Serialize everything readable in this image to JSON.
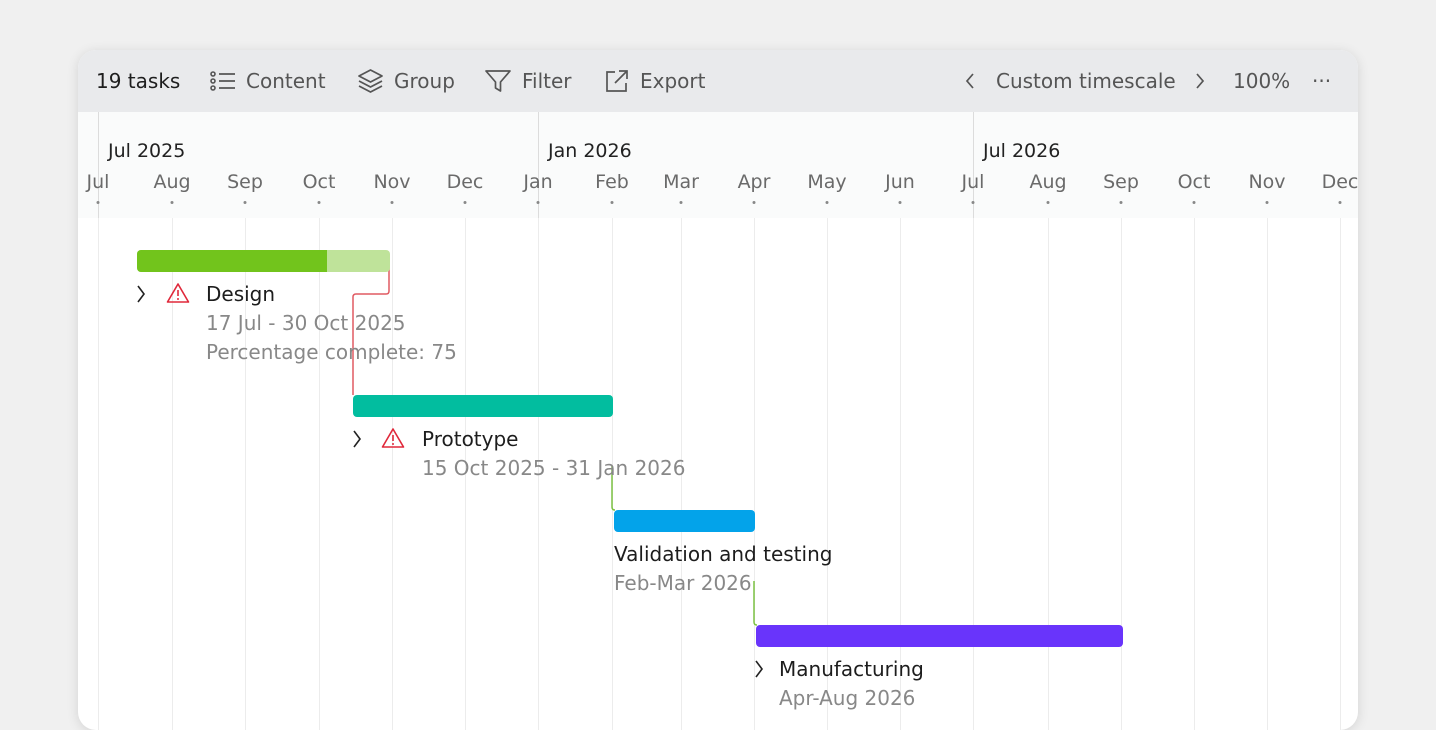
{
  "toolbar": {
    "task_count": "19 tasks",
    "content_label": "Content",
    "group_label": "Group",
    "filter_label": "Filter",
    "export_label": "Export",
    "timescale_label": "Custom timescale",
    "zoom_label": "100%",
    "more_label": "···"
  },
  "timeline": {
    "years": [
      "Jul 2025",
      "Jan 2026",
      "Jul 2026"
    ],
    "months": [
      "Jul",
      "Aug",
      "Sep",
      "Oct",
      "Nov",
      "Dec",
      "Jan",
      "Feb",
      "Mar",
      "Apr",
      "May",
      "Jun",
      "Jul",
      "Aug",
      "Sep",
      "Oct",
      "Nov",
      "Dec"
    ]
  },
  "tasks": [
    {
      "name": "Design",
      "dates": "17 Jul - 30 Oct 2025",
      "extra": "Percentage complete: 75",
      "color": "#72c41c",
      "light_color": "#bfe39a",
      "progress": 0.75,
      "warning": true,
      "expandable": true
    },
    {
      "name": "Prototype",
      "dates": "15 Oct 2025 - 31 Jan 2026",
      "color": "#02bd9f",
      "warning": true,
      "expandable": true
    },
    {
      "name": "Validation and testing",
      "dates": "Feb-Mar 2026",
      "color": "#03a3ea",
      "warning": false,
      "expandable": false
    },
    {
      "name": "Manufacturing",
      "dates": "Apr-Aug 2026",
      "color": "#6934fb",
      "warning": false,
      "expandable": true
    }
  ],
  "colors": {
    "warning": "#e0283a",
    "dependency_red": "#e05a62",
    "dependency_green": "#7cc243"
  }
}
